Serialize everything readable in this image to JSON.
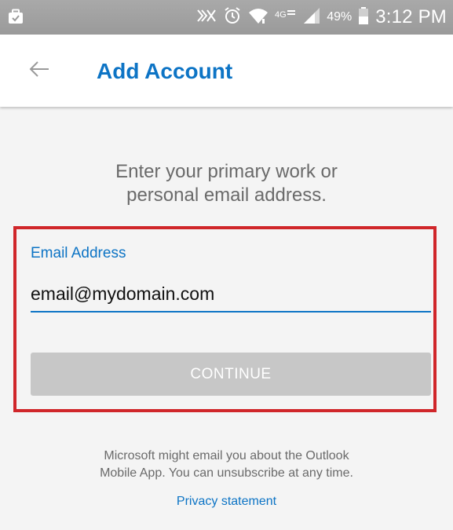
{
  "status_bar": {
    "battery_text": "49%",
    "time": "3:12 PM",
    "icons": [
      "briefcase-check-icon",
      "signal-boost-icon",
      "alarm-icon",
      "wifi-icon",
      "lte-icon",
      "cell-signal-icon",
      "battery-icon"
    ]
  },
  "app_bar": {
    "title": "Add Account",
    "back_icon": "arrow-left-icon"
  },
  "content": {
    "instruction_line1": "Enter your primary work or",
    "instruction_line2": "personal email address.",
    "email_label": "Email Address",
    "email_value": "email@mydomain.com",
    "continue_label": "CONTINUE",
    "footer_line1": "Microsoft might email you about the Outlook",
    "footer_line2": "Mobile App. You can unsubscribe at any time.",
    "privacy_link": "Privacy statement"
  },
  "colors": {
    "accent": "#0d74c5",
    "highlight_border": "#d0262a",
    "button_disabled": "#c7c7c7",
    "status_bar_bg": "#a0a0a0",
    "page_bg": "#f4f4f4"
  }
}
